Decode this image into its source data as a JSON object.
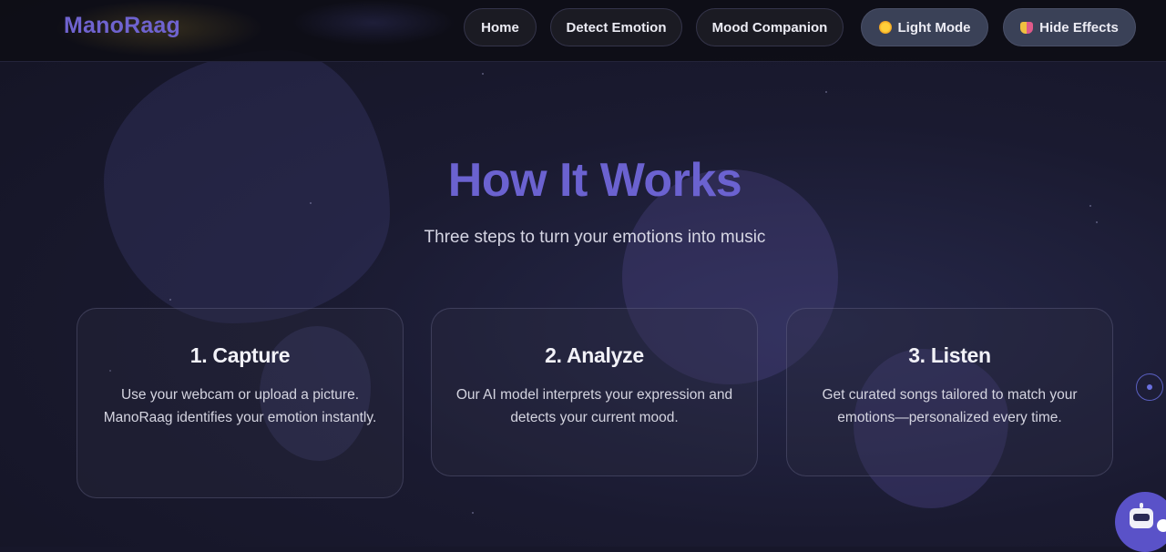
{
  "brand": {
    "name": "ManoRaag"
  },
  "nav": {
    "home": "Home",
    "detect": "Detect Emotion",
    "companion": "Mood Companion",
    "light_mode": "Light Mode",
    "hide_effects": "Hide Effects"
  },
  "icons": {
    "light_mode": "sun-icon",
    "hide_effects": "theater-masks-icon",
    "chat": "robot-icon",
    "scroll": "scroll-indicator-icon"
  },
  "hero": {
    "title": "How It Works",
    "subtitle": "Three steps to turn your emotions into music"
  },
  "steps": [
    {
      "title": "1. Capture",
      "text": "Use your webcam or upload a picture. ManoRaag identifies your emotion instantly."
    },
    {
      "title": "2. Analyze",
      "text": "Our AI model interprets your expression and detects your current mood."
    },
    {
      "title": "3. Listen",
      "text": "Get curated songs tailored to match your emotions—personalized every time."
    }
  ],
  "colors": {
    "accent": "#6b62d0",
    "background": "#17172a",
    "nav_background": "#1b1b23"
  }
}
